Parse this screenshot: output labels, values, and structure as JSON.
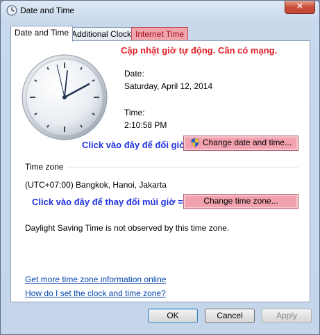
{
  "window": {
    "title": "Date and Time",
    "close_glyph": "✕"
  },
  "tabs": [
    {
      "label": "Date and Time"
    },
    {
      "label": "Additional Clocks"
    },
    {
      "label": "Internet Time"
    }
  ],
  "annotations": {
    "internet_time": "Cập nhật giờ tự động. Cần có mạng.",
    "change_date": "Click vào đây để đổi giờ",
    "change_zone": "Click vào đây để thay đổi múi giờ =>"
  },
  "datetime": {
    "date_label": "Date:",
    "date_value": "Saturday, April 12, 2014",
    "time_label": "Time:",
    "time_value": "2:10:58 PM",
    "change_button": "Change date and time..."
  },
  "timezone": {
    "section_label": "Time zone",
    "value": "(UTC+07:00) Bangkok, Hanoi, Jakarta",
    "change_button": "Change time zone...",
    "dst_text": "Daylight Saving Time is not observed by this time zone."
  },
  "links": {
    "more_info": "Get more time zone information online",
    "how_to": "How do I set the clock and time zone?"
  },
  "footer": {
    "ok": "OK",
    "cancel": "Cancel",
    "apply": "Apply"
  },
  "colors": {
    "annotation_red": "#e0202a",
    "annotation_blue": "#2233dd",
    "highlight_pink": "#f2a2ae"
  },
  "icons": [
    "clock-icon",
    "close-icon",
    "uac-shield-icon"
  ]
}
